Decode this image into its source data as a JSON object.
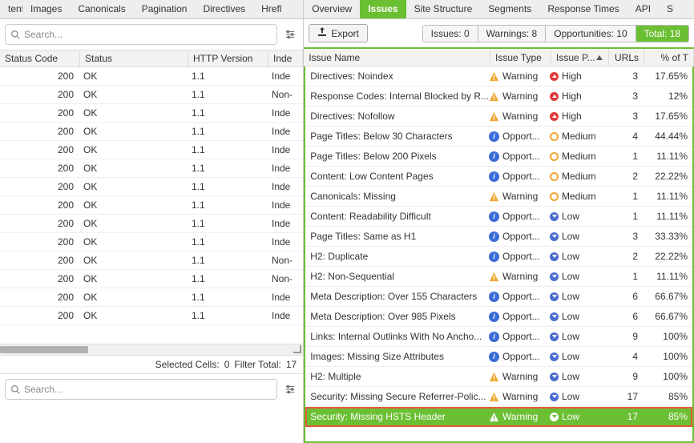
{
  "left": {
    "tabs": [
      "tent",
      "Images",
      "Canonicals",
      "Pagination",
      "Directives",
      "Hrefl"
    ],
    "search_placeholder": "Search...",
    "cols": [
      "Status Code",
      "Status",
      "HTTP Version",
      "Inde"
    ],
    "rows": [
      {
        "code": "200",
        "status": "OK",
        "http": "1.1",
        "idx": "Inde"
      },
      {
        "code": "200",
        "status": "OK",
        "http": "1.1",
        "idx": "Non-"
      },
      {
        "code": "200",
        "status": "OK",
        "http": "1.1",
        "idx": "Inde"
      },
      {
        "code": "200",
        "status": "OK",
        "http": "1.1",
        "idx": "Inde"
      },
      {
        "code": "200",
        "status": "OK",
        "http": "1.1",
        "idx": "Inde"
      },
      {
        "code": "200",
        "status": "OK",
        "http": "1.1",
        "idx": "Inde"
      },
      {
        "code": "200",
        "status": "OK",
        "http": "1.1",
        "idx": "Inde"
      },
      {
        "code": "200",
        "status": "OK",
        "http": "1.1",
        "idx": "Inde"
      },
      {
        "code": "200",
        "status": "OK",
        "http": "1.1",
        "idx": "Inde"
      },
      {
        "code": "200",
        "status": "OK",
        "http": "1.1",
        "idx": "Inde"
      },
      {
        "code": "200",
        "status": "OK",
        "http": "1.1",
        "idx": "Non-"
      },
      {
        "code": "200",
        "status": "OK",
        "http": "1.1",
        "idx": "Non-"
      },
      {
        "code": "200",
        "status": "OK",
        "http": "1.1",
        "idx": "Inde"
      },
      {
        "code": "200",
        "status": "OK",
        "http": "1.1",
        "idx": "Inde"
      }
    ],
    "footer": {
      "selected": "Selected Cells:",
      "selected_v": "0",
      "filter": "Filter Total:",
      "filter_v": "17"
    },
    "search2_placeholder": "Search..."
  },
  "right": {
    "tabs": [
      "Overview",
      "Issues",
      "Site Structure",
      "Segments",
      "Response Times",
      "API",
      "S"
    ],
    "active_tab": 1,
    "export_label": "Export",
    "summary": {
      "issues": "Issues: 0",
      "warnings": "Warnings: 8",
      "opps": "Opportunities: 10",
      "total": "Total: 18"
    },
    "cols": [
      "Issue Name",
      "Issue Type",
      "Issue P...",
      "URLs",
      "% of T"
    ],
    "rows": [
      {
        "name": "Directives: Noindex",
        "type": "Warning",
        "pri": "High",
        "urls": "3",
        "pct": "17.65%"
      },
      {
        "name": "Response Codes: Internal Blocked by R...",
        "type": "Warning",
        "pri": "High",
        "urls": "3",
        "pct": "12%"
      },
      {
        "name": "Directives: Nofollow",
        "type": "Warning",
        "pri": "High",
        "urls": "3",
        "pct": "17.65%"
      },
      {
        "name": "Page Titles: Below 30 Characters",
        "type": "Opport...",
        "pri": "Medium",
        "urls": "4",
        "pct": "44.44%"
      },
      {
        "name": "Page Titles: Below 200 Pixels",
        "type": "Opport...",
        "pri": "Medium",
        "urls": "1",
        "pct": "11.11%"
      },
      {
        "name": "Content: Low Content Pages",
        "type": "Opport...",
        "pri": "Medium",
        "urls": "2",
        "pct": "22.22%"
      },
      {
        "name": "Canonicals: Missing",
        "type": "Warning",
        "pri": "Medium",
        "urls": "1",
        "pct": "11.11%"
      },
      {
        "name": "Content: Readability Difficult",
        "type": "Opport...",
        "pri": "Low",
        "urls": "1",
        "pct": "11.11%"
      },
      {
        "name": "Page Titles: Same as H1",
        "type": "Opport...",
        "pri": "Low",
        "urls": "3",
        "pct": "33.33%"
      },
      {
        "name": "H2: Duplicate",
        "type": "Opport...",
        "pri": "Low",
        "urls": "2",
        "pct": "22.22%"
      },
      {
        "name": "H2: Non-Sequential",
        "type": "Warning",
        "pri": "Low",
        "urls": "1",
        "pct": "11.11%"
      },
      {
        "name": "Meta Description: Over 155 Characters",
        "type": "Opport...",
        "pri": "Low",
        "urls": "6",
        "pct": "66.67%"
      },
      {
        "name": "Meta Description: Over 985 Pixels",
        "type": "Opport...",
        "pri": "Low",
        "urls": "6",
        "pct": "66.67%"
      },
      {
        "name": "Links: Internal Outlinks With No Ancho...",
        "type": "Opport...",
        "pri": "Low",
        "urls": "9",
        "pct": "100%"
      },
      {
        "name": "Images: Missing Size Attributes",
        "type": "Opport...",
        "pri": "Low",
        "urls": "4",
        "pct": "100%"
      },
      {
        "name": "H2: Multiple",
        "type": "Warning",
        "pri": "Low",
        "urls": "9",
        "pct": "100%"
      },
      {
        "name": "Security: Missing Secure Referrer-Polic...",
        "type": "Warning",
        "pri": "Low",
        "urls": "17",
        "pct": "85%"
      },
      {
        "name": "Security: Missing HSTS Header",
        "type": "Warning",
        "pri": "Low",
        "urls": "17",
        "pct": "85%",
        "sel": true
      }
    ]
  }
}
